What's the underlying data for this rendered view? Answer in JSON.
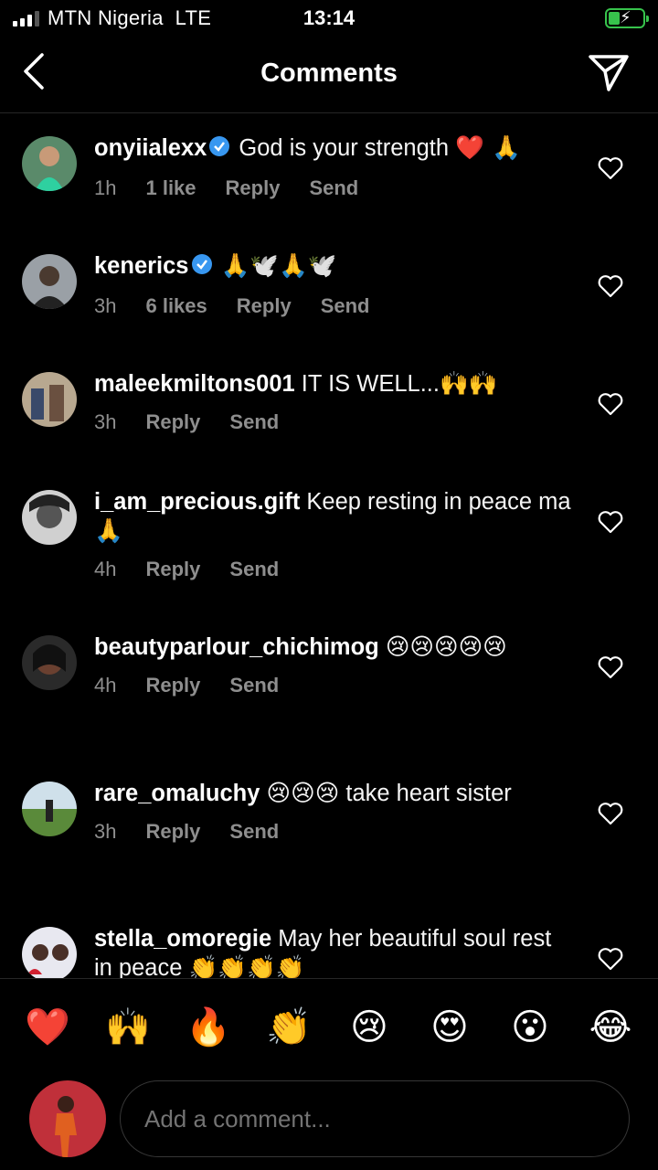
{
  "status_bar": {
    "carrier": "MTN Nigeria",
    "network": "LTE",
    "time": "13:14",
    "battery_state": "charging",
    "battery_color": "#37c34c"
  },
  "header": {
    "title": "Comments",
    "back_icon": "chevron-left-icon",
    "share_icon": "paper-plane-icon"
  },
  "actions": {
    "reply": "Reply",
    "send": "Send"
  },
  "comments": [
    {
      "username": "onyiialexx",
      "verified": true,
      "text": " God is your strength ",
      "emoji": "❤️ 🙏",
      "time": "1h",
      "likes": "1 like"
    },
    {
      "username": "kenerics",
      "verified": true,
      "text": " ",
      "emoji": "🙏🕊️🙏🕊️",
      "time": "3h",
      "likes": "6 likes"
    },
    {
      "username": "maleekmiltons001",
      "verified": false,
      "text": " IT IS WELL...",
      "emoji": "🙌🙌",
      "time": "3h",
      "likes": ""
    },
    {
      "username": "i_am_precious.gift",
      "verified": false,
      "text": " Keep resting in peace ma",
      "emoji": "🙏",
      "time": "4h",
      "likes": ""
    },
    {
      "username": "beautyparlour_chichimog",
      "verified": false,
      "text": " ",
      "emoji": "😢😢😢😢😢",
      "time": "4h",
      "likes": ""
    },
    {
      "username": "rare_omaluchy",
      "verified": false,
      "text": " ",
      "emoji": "😢😢😢",
      "text_after": "  take heart sister",
      "time": "3h",
      "likes": ""
    },
    {
      "username": "stella_omoregie",
      "verified": false,
      "text": " May her beautiful soul rest in peace ",
      "emoji": "👏👏👏👏",
      "time": "",
      "likes": ""
    }
  ],
  "quick_emojis": [
    "❤️",
    "🙌",
    "🔥",
    "👏",
    "😢",
    "😍",
    "😮",
    "😂"
  ],
  "composer": {
    "placeholder": "Add a comment..."
  }
}
